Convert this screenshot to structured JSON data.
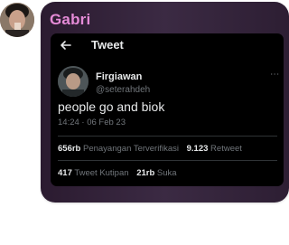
{
  "sender": {
    "name": "Gabri"
  },
  "tweet": {
    "header_title": "Tweet",
    "display_name": "Firgiawan",
    "handle": "@seterahdeh",
    "text": "people go and biok",
    "timestamp": "14:24 · 06 Feb 23",
    "stats": {
      "views_count": "656rb",
      "views_label": "Penayangan Terverifikasi",
      "retweet_count": "9.123",
      "retweet_label": "Retweet",
      "quote_count": "417",
      "quote_label": "Tweet Kutipan",
      "like_count": "21rb",
      "like_label": "Suka"
    }
  },
  "colors": {
    "sender_name": "#e58bd7",
    "bubble": "#3b2a43",
    "tweet_bg": "#000000"
  }
}
